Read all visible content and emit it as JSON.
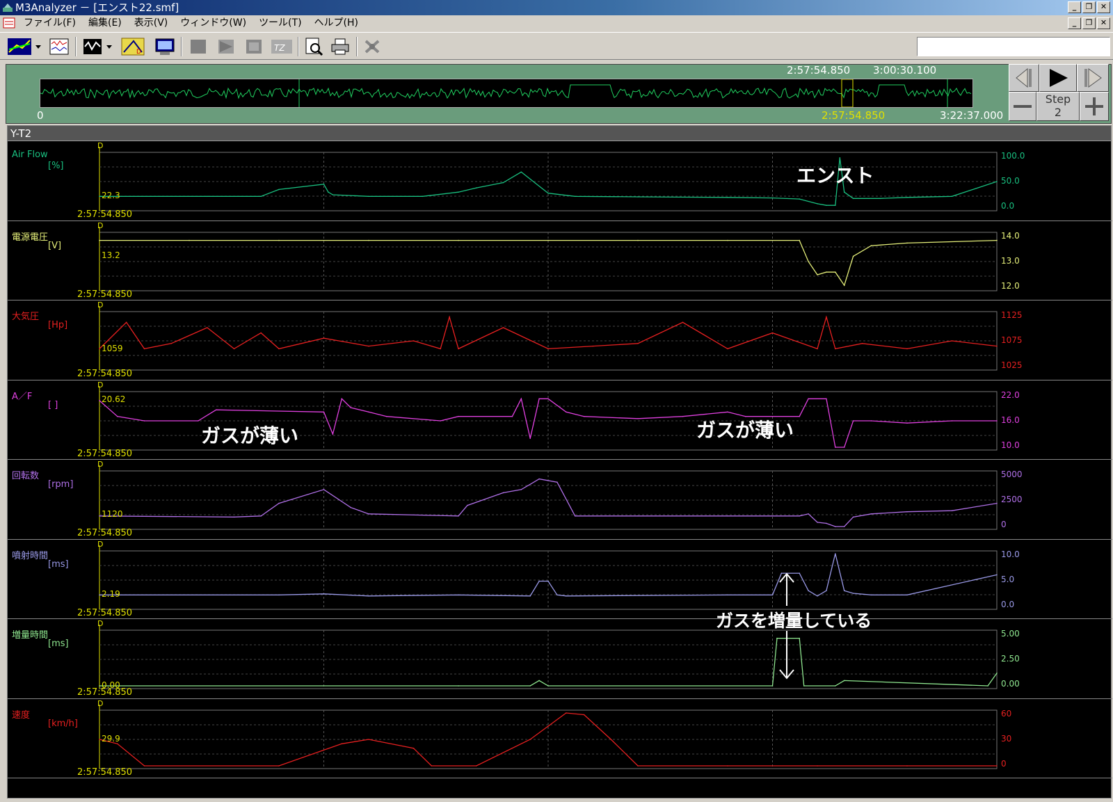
{
  "window": {
    "title": "M3Analyzer － [エンスト22.smf]",
    "minimize": "_",
    "restore": "❐",
    "close": "✕"
  },
  "menu": {
    "items": [
      "ファイル(F)",
      "編集(E)",
      "表示(V)",
      "ウィンドウ(W)",
      "ツール(T)",
      "ヘルプ(H)"
    ]
  },
  "overview": {
    "range_start": "2:57:54.850",
    "range_end": "3:00:30.100",
    "axis_start": "0",
    "cursor_time": "2:57:54.850",
    "total_time": "3:22:37.000",
    "step_label": "Step",
    "step_value": "2"
  },
  "chart_header": "Y-T2",
  "colors": {
    "airflow": "#19c080",
    "voltage": "#e6f07a",
    "pressure": "#e82020",
    "af": "#e040e0",
    "rpm": "#b070e8",
    "injection": "#9a9ae8",
    "enrich": "#90e890",
    "speed": "#e82020"
  },
  "chart_data": [
    {
      "type": "line",
      "name": "Air Flow",
      "unit": "[%]",
      "current": "22.3",
      "time": "2:57:54.850",
      "ticks": [
        "100.0",
        "50.0",
        "0.0"
      ],
      "ylim": [
        0,
        100
      ],
      "x": [
        0,
        12,
        18,
        20,
        25,
        25.5,
        26,
        30,
        36,
        40,
        42,
        45,
        47,
        50,
        53,
        60,
        70,
        75,
        78,
        80,
        81,
        82,
        82.5,
        83,
        84,
        87,
        90,
        95,
        100
      ],
      "values": [
        22,
        22,
        22,
        35,
        45,
        30,
        25,
        22,
        22,
        30,
        38,
        48,
        68,
        28,
        22,
        21,
        20,
        19,
        17,
        8,
        5,
        5,
        95,
        30,
        18,
        18,
        20,
        22,
        50
      ]
    },
    {
      "type": "line",
      "name": "電源電圧",
      "unit": "[V]",
      "current": "13.2",
      "time": "2:57:54.850",
      "ticks": [
        "14.0",
        "13.0",
        "12.0"
      ],
      "ylim": [
        12,
        14
      ],
      "x": [
        0,
        10,
        20,
        30,
        40,
        50,
        60,
        70,
        78,
        79,
        80,
        81,
        82,
        83,
        84,
        86,
        90,
        100
      ],
      "values": [
        13.8,
        13.8,
        13.8,
        13.8,
        13.8,
        13.8,
        13.8,
        13.8,
        13.8,
        13.0,
        12.5,
        12.6,
        12.6,
        12.1,
        13.2,
        13.6,
        13.7,
        13.8
      ]
    },
    {
      "type": "line",
      "name": "大気圧",
      "unit": "[Hp]",
      "current": "1059",
      "time": "2:57:54.850",
      "ticks": [
        "1125",
        "1075",
        "1025"
      ],
      "ylim": [
        1025,
        1125
      ],
      "x": [
        0,
        3,
        5,
        8,
        12,
        15,
        18,
        20,
        25,
        30,
        35,
        38,
        39,
        40,
        45,
        50,
        55,
        60,
        65,
        70,
        75,
        80,
        81,
        82,
        85,
        90,
        95,
        100
      ],
      "values": [
        1060,
        1110,
        1060,
        1070,
        1100,
        1060,
        1090,
        1060,
        1080,
        1065,
        1075,
        1060,
        1120,
        1060,
        1100,
        1060,
        1065,
        1070,
        1110,
        1060,
        1090,
        1060,
        1120,
        1060,
        1070,
        1060,
        1075,
        1065
      ]
    },
    {
      "type": "line",
      "name": "A／F",
      "unit": "[ ]",
      "current": "20.62",
      "time": "2:57:54.850",
      "ticks": [
        "22.0",
        "16.0",
        "10.0"
      ],
      "ylim": [
        10,
        22
      ],
      "x": [
        0,
        2,
        5,
        11,
        13,
        25,
        26,
        27,
        28,
        30,
        32,
        38,
        40,
        46,
        47,
        48,
        49,
        50,
        52,
        54,
        60,
        65,
        70,
        72,
        75,
        78,
        79,
        81,
        82,
        83,
        84,
        86,
        90,
        95,
        100
      ],
      "values": [
        20.6,
        17,
        16,
        16,
        18.5,
        18,
        13,
        21,
        19,
        18,
        17,
        16,
        17,
        17,
        21,
        12,
        21,
        21,
        18,
        17,
        16.5,
        17,
        18,
        17,
        17,
        17,
        21,
        21,
        10,
        10,
        16,
        16,
        15.5,
        16,
        16
      ]
    },
    {
      "type": "line",
      "name": "回転数",
      "unit": "[rpm]",
      "current": "1120",
      "time": "2:57:54.850",
      "ticks": [
        "5000",
        "2500",
        "0"
      ],
      "ylim": [
        0,
        5000
      ],
      "x": [
        0,
        15,
        18,
        20,
        25,
        28,
        30,
        40,
        41,
        45,
        47,
        49,
        51,
        53,
        60,
        70,
        78,
        79,
        80,
        81,
        82,
        83,
        84,
        86,
        90,
        95,
        100
      ],
      "values": [
        1000,
        900,
        1000,
        2200,
        3500,
        1800,
        1200,
        1000,
        2000,
        3200,
        3500,
        4500,
        4200,
        1000,
        1000,
        1000,
        1000,
        1200,
        400,
        300,
        0,
        0,
        900,
        1200,
        1400,
        1500,
        2200
      ]
    },
    {
      "type": "line",
      "name": "噴射時間",
      "unit": "[ms]",
      "current": "2.19",
      "time": "2:57:54.850",
      "ticks": [
        "10.0",
        "5.0",
        "0.0"
      ],
      "ylim": [
        0,
        10
      ],
      "x": [
        0,
        20,
        25,
        30,
        40,
        48,
        49,
        50,
        51,
        52,
        70,
        75,
        76,
        78,
        79,
        80,
        81,
        82,
        83,
        84,
        86,
        90,
        100
      ],
      "values": [
        2.2,
        2.2,
        2.4,
        2.0,
        2.2,
        2.0,
        4.8,
        4.8,
        2.2,
        2.0,
        2.2,
        2.2,
        6.3,
        6.3,
        3.0,
        2.0,
        3.0,
        10,
        3.0,
        2.5,
        2.2,
        2.2,
        6.0
      ]
    },
    {
      "type": "line",
      "name": "増量時間",
      "unit": "[ms]",
      "current": "0.00",
      "time": "2:57:54.850",
      "ticks": [
        "5.00",
        "2.50",
        "0.00"
      ],
      "ylim": [
        0,
        5
      ],
      "x": [
        0,
        40,
        48,
        49,
        50,
        75,
        75.5,
        78,
        78.5,
        82,
        83,
        99,
        100
      ],
      "values": [
        0,
        0,
        0,
        0.5,
        0,
        0,
        4.5,
        4.5,
        0,
        0,
        0.5,
        0,
        1.2
      ]
    },
    {
      "type": "line",
      "name": "速度",
      "unit": "[km/h]",
      "current": "29.9",
      "time": "2:57:54.850",
      "ticks": [
        "60",
        "30",
        "0"
      ],
      "ylim": [
        0,
        60
      ],
      "x": [
        0,
        2,
        5,
        20,
        27,
        30,
        35,
        37,
        42,
        48,
        50,
        52,
        54,
        57,
        60,
        70,
        80,
        90,
        100
      ],
      "values": [
        30,
        25,
        0,
        0,
        25,
        30,
        20,
        0,
        0,
        30,
        45,
        60,
        58,
        30,
        0,
        0,
        0,
        0,
        0
      ]
    }
  ],
  "annotations": {
    "stall": "エンスト",
    "lean1": "ガスが薄い",
    "lean2": "ガスが薄い",
    "enrich": "ガスを増量している"
  }
}
